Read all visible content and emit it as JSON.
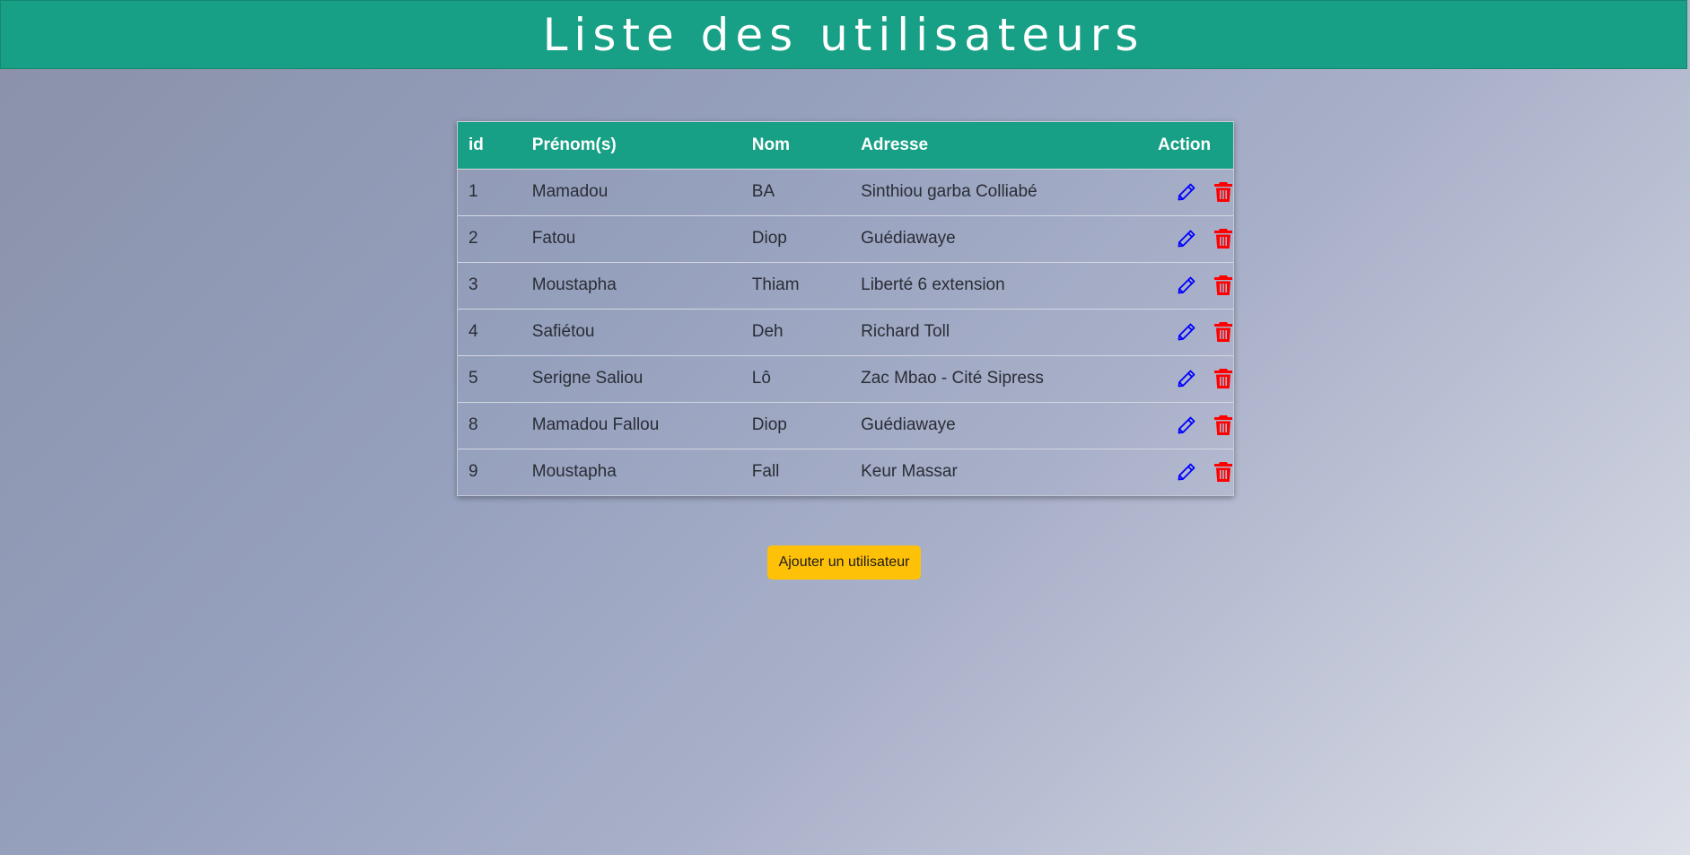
{
  "header": {
    "title": "Liste des utilisateurs"
  },
  "table": {
    "columns": [
      "id",
      "Prénom(s)",
      "Nom",
      "Adresse",
      "Action"
    ],
    "rows": [
      {
        "id": "1",
        "prenom": "Mamadou",
        "nom": "BA",
        "adresse": "Sinthiou garba Colliabé"
      },
      {
        "id": "2",
        "prenom": "Fatou",
        "nom": "Diop",
        "adresse": "Guédiawaye"
      },
      {
        "id": "3",
        "prenom": "Moustapha",
        "nom": "Thiam",
        "adresse": "Liberté 6 extension"
      },
      {
        "id": "4",
        "prenom": "Safiétou",
        "nom": "Deh",
        "adresse": "Richard Toll"
      },
      {
        "id": "5",
        "prenom": "Serigne Saliou",
        "nom": "Lô",
        "adresse": "Zac Mbao - Cité Sipress"
      },
      {
        "id": "8",
        "prenom": "Mamadou Fallou",
        "nom": "Diop",
        "adresse": "Guédiawaye"
      },
      {
        "id": "9",
        "prenom": "Moustapha",
        "nom": "Fall",
        "adresse": "Keur Massar"
      }
    ],
    "action_icons": {
      "edit": "pencil-icon",
      "delete": "trash-icon"
    }
  },
  "add_button": {
    "label": "Ajouter un utilisateur"
  },
  "colors": {
    "header_bg": "#17a085",
    "edit_icon": "#0000ff",
    "delete_icon": "#ff0000",
    "add_button_bg": "#ffc107"
  }
}
